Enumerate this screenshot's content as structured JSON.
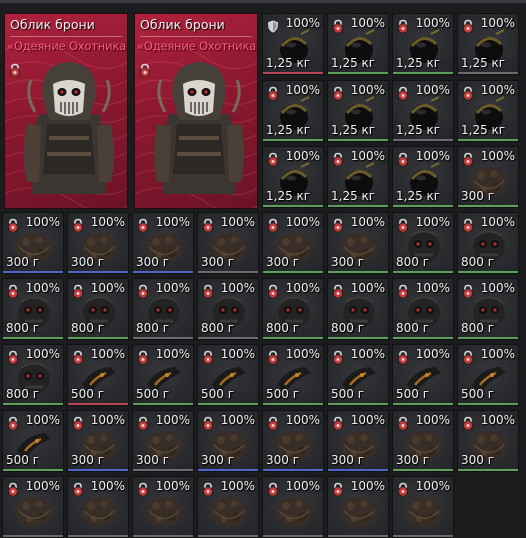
{
  "skins": [
    {
      "title": "Облик брони",
      "subtitle": "«Одеяние Охотника»"
    },
    {
      "title": "Облик брони",
      "subtitle": "«Одеяние Охотника»"
    }
  ],
  "colors": {
    "grey": "#6a6c70",
    "green": "#5c9e5a",
    "blue": "#4e64c8",
    "red": "#b84458",
    "skin_bg": "#9e1d38"
  },
  "items": [
    {
      "pct": "100%",
      "weight": "1,25 кг",
      "lock": "shield",
      "icon": "helmet-icon",
      "rarity": "red"
    },
    {
      "pct": "100%",
      "weight": "1,25 кг",
      "lock": "lock",
      "icon": "helmet-icon",
      "rarity": "green"
    },
    {
      "pct": "100%",
      "weight": "1,25 кг",
      "lock": "lock",
      "icon": "helmet-icon",
      "rarity": "green"
    },
    {
      "pct": "100%",
      "weight": "1,25 кг",
      "lock": "lock",
      "icon": "helmet-icon",
      "rarity": "grey"
    },
    {
      "pct": "100%",
      "weight": "1,25 кг",
      "lock": "lock",
      "icon": "helmet-icon",
      "rarity": "green"
    },
    {
      "pct": "100%",
      "weight": "1,25 кг",
      "lock": "lock",
      "icon": "helmet-icon",
      "rarity": "green"
    },
    {
      "pct": "100%",
      "weight": "1,25 кг",
      "lock": "lock",
      "icon": "helmet-icon",
      "rarity": "grey"
    },
    {
      "pct": "100%",
      "weight": "1,25 кг",
      "lock": "lock",
      "icon": "helmet-icon",
      "rarity": "green"
    },
    {
      "pct": "100%",
      "weight": "1,25 кг",
      "lock": "lock",
      "icon": "helmet-icon",
      "rarity": "green"
    },
    {
      "pct": "100%",
      "weight": "1,25 кг",
      "lock": "lock",
      "icon": "helmet-icon",
      "rarity": "green"
    },
    {
      "pct": "100%",
      "weight": "1,25 кг",
      "lock": "lock",
      "icon": "helmet-icon",
      "rarity": "green"
    },
    {
      "pct": "100%",
      "weight": "300 г",
      "lock": "lock",
      "icon": "glove-icon",
      "rarity": "green"
    },
    {
      "pct": "100%",
      "weight": "300 г",
      "lock": "lock",
      "icon": "glove-icon",
      "rarity": "blue"
    },
    {
      "pct": "100%",
      "weight": "300 г",
      "lock": "lock",
      "icon": "glove-icon",
      "rarity": "blue"
    },
    {
      "pct": "100%",
      "weight": "300 г",
      "lock": "lock",
      "icon": "glove-icon",
      "rarity": "blue"
    },
    {
      "pct": "100%",
      "weight": "300 г",
      "lock": "lock",
      "icon": "glove-icon",
      "rarity": "grey"
    },
    {
      "pct": "100%",
      "weight": "300 г",
      "lock": "lock",
      "icon": "glove-icon",
      "rarity": "green"
    },
    {
      "pct": "100%",
      "weight": "300 г",
      "lock": "lock",
      "icon": "glove-icon",
      "rarity": "green"
    },
    {
      "pct": "100%",
      "weight": "800 г",
      "lock": "lock",
      "icon": "mask-icon",
      "rarity": "green"
    },
    {
      "pct": "100%",
      "weight": "800 г",
      "lock": "lock",
      "icon": "mask-icon",
      "rarity": "green"
    },
    {
      "pct": "100%",
      "weight": "800 г",
      "lock": "lock",
      "icon": "mask-icon",
      "rarity": "green"
    },
    {
      "pct": "100%",
      "weight": "800 г",
      "lock": "lock",
      "icon": "mask-icon",
      "rarity": "green"
    },
    {
      "pct": "100%",
      "weight": "800 г",
      "lock": "lock",
      "icon": "mask-icon",
      "rarity": "grey"
    },
    {
      "pct": "100%",
      "weight": "800 г",
      "lock": "lock",
      "icon": "mask-icon",
      "rarity": "grey"
    },
    {
      "pct": "100%",
      "weight": "800 г",
      "lock": "lock",
      "icon": "mask-icon",
      "rarity": "green"
    },
    {
      "pct": "100%",
      "weight": "800 г",
      "lock": "lock",
      "icon": "mask-icon",
      "rarity": "green"
    },
    {
      "pct": "100%",
      "weight": "800 г",
      "lock": "lock",
      "icon": "mask-icon",
      "rarity": "green"
    },
    {
      "pct": "100%",
      "weight": "800 г",
      "lock": "lock",
      "icon": "mask-icon",
      "rarity": "green"
    },
    {
      "pct": "100%",
      "weight": "800 г",
      "lock": "lock",
      "icon": "mask-icon",
      "rarity": "green"
    },
    {
      "pct": "100%",
      "weight": "500 г",
      "lock": "lock",
      "icon": "armband-icon",
      "rarity": "red"
    },
    {
      "pct": "100%",
      "weight": "500 г",
      "lock": "lock",
      "icon": "armband-icon",
      "rarity": "green"
    },
    {
      "pct": "100%",
      "weight": "500 г",
      "lock": "lock",
      "icon": "armband-icon",
      "rarity": "green"
    },
    {
      "pct": "100%",
      "weight": "500 г",
      "lock": "lock",
      "icon": "armband-icon",
      "rarity": "green"
    },
    {
      "pct": "100%",
      "weight": "500 г",
      "lock": "lock",
      "icon": "armband-icon",
      "rarity": "green"
    },
    {
      "pct": "100%",
      "weight": "500 г",
      "lock": "lock",
      "icon": "armband-icon",
      "rarity": "green"
    },
    {
      "pct": "100%",
      "weight": "500 г",
      "lock": "lock",
      "icon": "armband-icon",
      "rarity": "green"
    },
    {
      "pct": "100%",
      "weight": "500 г",
      "lock": "lock",
      "icon": "armband-icon",
      "rarity": "green"
    },
    {
      "pct": "100%",
      "weight": "300 г",
      "lock": "lock",
      "icon": "glove-icon",
      "rarity": "blue"
    },
    {
      "pct": "100%",
      "weight": "300 г",
      "lock": "lock",
      "icon": "glove-icon",
      "rarity": "grey"
    },
    {
      "pct": "100%",
      "weight": "300 г",
      "lock": "lock",
      "icon": "glove-icon",
      "rarity": "blue"
    },
    {
      "pct": "100%",
      "weight": "300 г",
      "lock": "lock",
      "icon": "glove-icon",
      "rarity": "blue"
    },
    {
      "pct": "100%",
      "weight": "300 г",
      "lock": "lock",
      "icon": "glove-icon",
      "rarity": "blue"
    },
    {
      "pct": "100%",
      "weight": "300 г",
      "lock": "lock",
      "icon": "glove-icon",
      "rarity": "green"
    },
    {
      "pct": "100%",
      "weight": "300 г",
      "lock": "lock",
      "icon": "glove-icon",
      "rarity": "green"
    },
    {
      "pct": "100%",
      "weight": "",
      "lock": "lock",
      "icon": "glove-icon",
      "rarity": "grey"
    },
    {
      "pct": "100%",
      "weight": "",
      "lock": "lock",
      "icon": "glove-icon",
      "rarity": "grey"
    },
    {
      "pct": "100%",
      "weight": "",
      "lock": "lock",
      "icon": "glove-icon",
      "rarity": "grey"
    },
    {
      "pct": "100%",
      "weight": "",
      "lock": "lock",
      "icon": "glove-icon",
      "rarity": "grey"
    },
    {
      "pct": "100%",
      "weight": "",
      "lock": "lock",
      "icon": "glove-icon",
      "rarity": "grey"
    },
    {
      "pct": "100%",
      "weight": "",
      "lock": "lock",
      "icon": "glove-icon",
      "rarity": "grey"
    },
    {
      "pct": "100%",
      "weight": "",
      "lock": "lock",
      "icon": "glove-icon",
      "rarity": "grey"
    }
  ]
}
